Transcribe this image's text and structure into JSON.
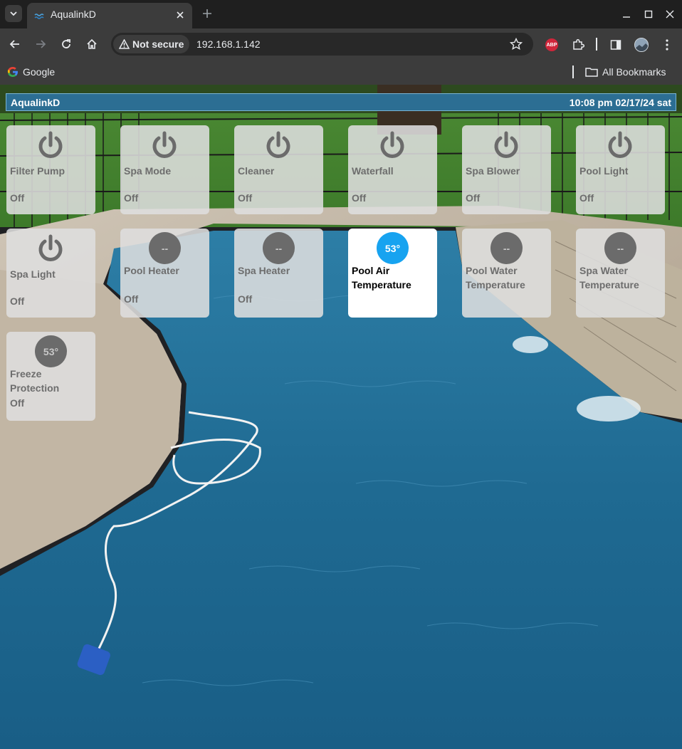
{
  "browser": {
    "tab_title": "AqualinkD",
    "security_label": "Not secure",
    "url": "192.168.1.142",
    "bookmarks": [
      {
        "label": "Google",
        "icon": "google-icon"
      },
      {
        "label": "All Bookmarks",
        "icon": "folder-icon"
      }
    ],
    "extension_badge": "ABP"
  },
  "app": {
    "title": "AqualinkD",
    "datetime": "10:08 pm 02/17/24 sat"
  },
  "devices": [
    {
      "name": "Filter Pump",
      "state": "Off",
      "kind": "switch"
    },
    {
      "name": "Spa Mode",
      "state": "Off",
      "kind": "switch"
    },
    {
      "name": "Cleaner",
      "state": "Off",
      "kind": "switch"
    },
    {
      "name": "Waterfall",
      "state": "Off",
      "kind": "switch"
    },
    {
      "name": "Spa Blower",
      "state": "Off",
      "kind": "switch"
    },
    {
      "name": "Pool Light",
      "state": "Off",
      "kind": "switch"
    },
    {
      "name": "Spa Light",
      "state": "Off",
      "kind": "switch"
    },
    {
      "name": "Pool Heater",
      "state": "Off",
      "kind": "heater",
      "reading": "--"
    },
    {
      "name": "Spa Heater",
      "state": "Off",
      "kind": "heater",
      "reading": "--"
    },
    {
      "name": "Pool Air Temperature",
      "state": "",
      "kind": "sensor",
      "reading": "53°",
      "active": true
    },
    {
      "name": "Pool Water Temperature",
      "state": "",
      "kind": "sensor",
      "reading": "--"
    },
    {
      "name": "Spa Water Temperature",
      "state": "",
      "kind": "sensor",
      "reading": "--"
    },
    {
      "name": "Freeze Protection",
      "state": "Off",
      "kind": "freeze",
      "reading": "53°"
    }
  ],
  "colors": {
    "titlebar": "#2c6e93",
    "active_reading": "#17a3f0",
    "inactive_reading": "#6b6b6b"
  }
}
